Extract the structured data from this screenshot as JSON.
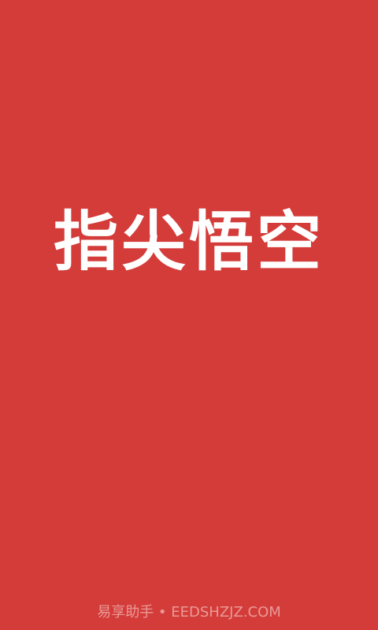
{
  "app": {
    "logo_text": "指尖悟空"
  },
  "watermark": {
    "text": "易享助手 • EEDSHZJZ.COM"
  },
  "colors": {
    "background": "#d43c3a",
    "logo": "#ffffff",
    "watermark": "#e99a97"
  }
}
